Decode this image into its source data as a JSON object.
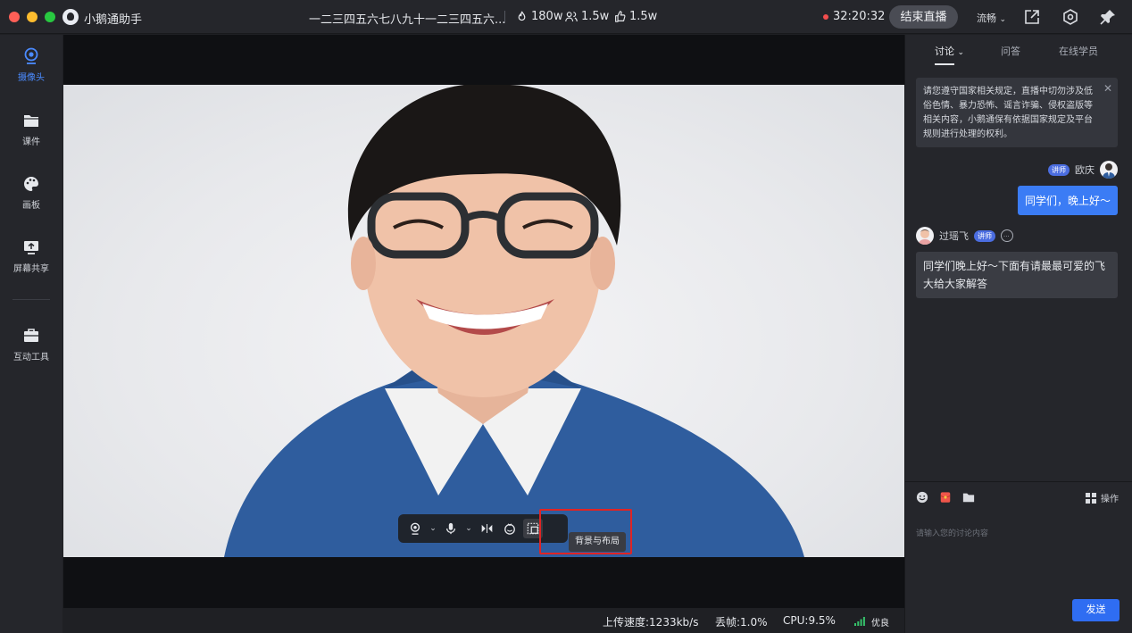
{
  "window": {
    "traffic_lights": [
      "#ff5f57",
      "#febc2e",
      "#28c840"
    ],
    "app_name": "小鹅通助手",
    "live_title": "一二三四五六七八九十一二三四五六...",
    "stats": {
      "views": "180w",
      "online": "1.5w",
      "likes": "1.5w"
    },
    "timer": "32:20:32",
    "end_live_label": "结束直播",
    "quality_label": "流畅"
  },
  "sidebar": {
    "items": [
      {
        "label": "摄像头",
        "icon": "camera-icon",
        "active": true
      },
      {
        "label": "课件",
        "icon": "folder-icon",
        "active": false
      },
      {
        "label": "画板",
        "icon": "palette-icon",
        "active": false
      },
      {
        "label": "屏幕共享",
        "icon": "screen-share-icon",
        "active": false
      },
      {
        "label": "互动工具",
        "icon": "toolbox-icon",
        "active": false
      }
    ]
  },
  "video_toolbar": {
    "tools": [
      "camera-icon",
      "microphone-icon",
      "mirror-icon",
      "beauty-icon",
      "background-layout-icon"
    ],
    "tooltip": "背景与布局"
  },
  "status_bar": {
    "upload_label": "上传速度:",
    "upload_value": "1233kb/s",
    "drop_label": "丢帧:",
    "drop_value": "1.0%",
    "cpu_label": "CPU:",
    "cpu_value": "9.5%",
    "network_label": "优良"
  },
  "chat": {
    "tabs": [
      "讨论",
      "问答",
      "在线学员"
    ],
    "notice": "请您遵守国家相关规定，直播中切勿涉及低俗色情、暴力恐怖、谣言诈骗、侵权盗版等相关内容，小鹅通保有依据国家规定及平台规则进行处理的权利。",
    "messages": [
      {
        "sender": "欧庆",
        "badge": "讲师",
        "text": "同学们，晚上好～",
        "side": "right"
      },
      {
        "sender": "过瑶飞",
        "badge": "讲师",
        "text": "同学们晚上好～下面有请最最可爱的飞大给大家解答",
        "side": "left"
      }
    ],
    "operation_label": "操作",
    "input_placeholder": "请输入您的讨论内容",
    "send_label": "发送"
  }
}
